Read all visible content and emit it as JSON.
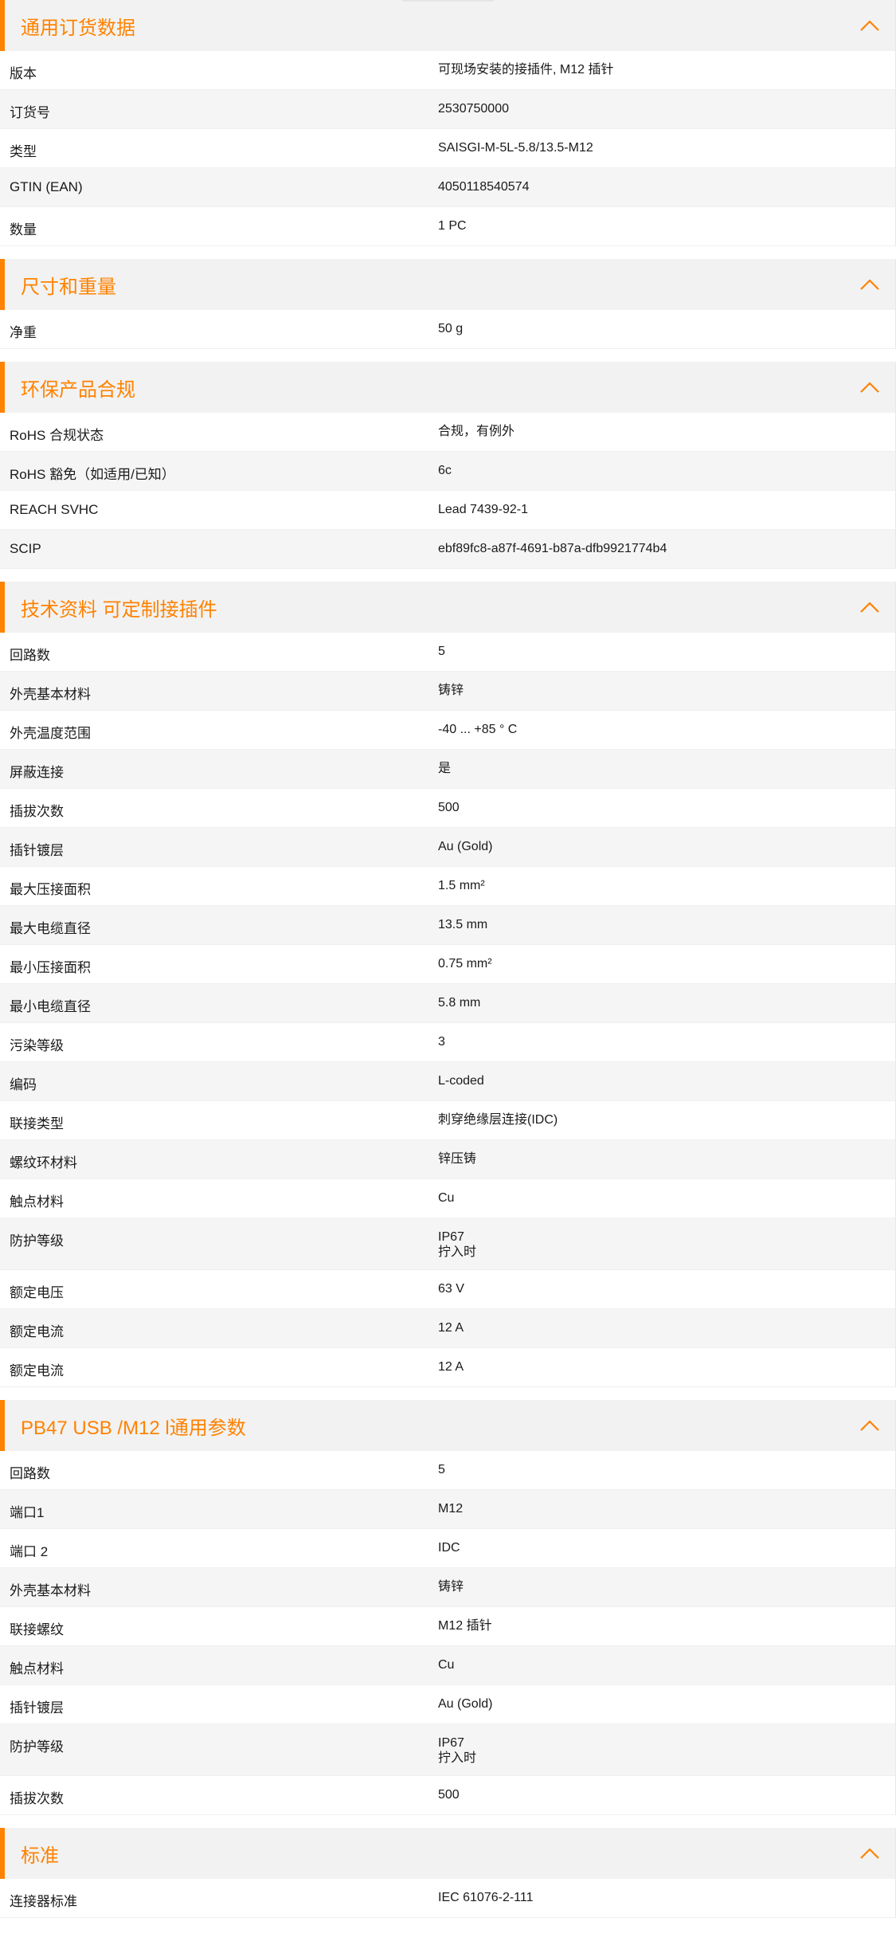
{
  "accent_color": "#ff8200",
  "icon_collapse": "chevron-up-icon",
  "sections": [
    {
      "title": "通用订货数据",
      "rows": [
        {
          "key": "版本",
          "value": "可现场安装的接插件, M12 插针"
        },
        {
          "key": "订货号",
          "value": "2530750000"
        },
        {
          "key": "类型",
          "value": "SAISGI-M-5L-5.8/13.5-M12"
        },
        {
          "key": "GTIN (EAN)",
          "value": "4050118540574"
        },
        {
          "key": "数量",
          "value": "1  PC"
        }
      ]
    },
    {
      "title": "尺寸和重量",
      "rows": [
        {
          "key": "净重",
          "value": "50  g"
        }
      ]
    },
    {
      "title": "环保产品合规",
      "rows": [
        {
          "key": "RoHS 合规状态",
          "value": "合规，有例外"
        },
        {
          "key": "RoHS 豁免（如适用/已知）",
          "value": "6c"
        },
        {
          "key": "REACH SVHC",
          "value": "Lead 7439-92-1"
        },
        {
          "key": "SCIP",
          "value": "ebf89fc8-a87f-4691-b87a-dfb9921774b4"
        }
      ]
    },
    {
      "title": "技术资料 可定制接插件",
      "rows": [
        {
          "key": "回路数",
          "value": "5"
        },
        {
          "key": "外壳基本材料",
          "value": "铸锌"
        },
        {
          "key": "外壳温度范围",
          "value": "-40 ... +85 ° C"
        },
        {
          "key": "屏蔽连接",
          "value": "是"
        },
        {
          "key": "插拔次数",
          "value": "500"
        },
        {
          "key": "插针镀层",
          "value": "Au (Gold)"
        },
        {
          "key": "最大压接面积",
          "value": "1.5  mm²"
        },
        {
          "key": "最大电缆直径",
          "value": "13.5  mm"
        },
        {
          "key": "最小压接面积",
          "value": "0.75  mm²"
        },
        {
          "key": "最小电缆直径",
          "value": "5.8  mm"
        },
        {
          "key": "污染等级",
          "value": "3"
        },
        {
          "key": "编码",
          "value": "L-coded"
        },
        {
          "key": "联接类型",
          "value": "刺穿绝缘层连接(IDC)"
        },
        {
          "key": "螺纹环材料",
          "value": "锌压铸"
        },
        {
          "key": "触点材料",
          "value": "Cu"
        },
        {
          "key": "防护等级",
          "value": "IP67\n拧入时"
        },
        {
          "key": "额定电压",
          "value": "63  V"
        },
        {
          "key": "额定电流",
          "value": "12  A"
        },
        {
          "key": "额定电流",
          "value": "12 A"
        }
      ]
    },
    {
      "title": "PB47 USB /M12 l通用参数",
      "rows": [
        {
          "key": "回路数",
          "value": "5"
        },
        {
          "key": "端口1",
          "value": "M12"
        },
        {
          "key": "端口 2",
          "value": "IDC"
        },
        {
          "key": "外壳基本材料",
          "value": "铸锌"
        },
        {
          "key": "联接螺纹",
          "value": "M12 插针"
        },
        {
          "key": "触点材料",
          "value": "Cu"
        },
        {
          "key": "插针镀层",
          "value": "Au (Gold)"
        },
        {
          "key": "防护等级",
          "value": "IP67\n拧入时"
        },
        {
          "key": "插拔次数",
          "value": "500"
        }
      ]
    },
    {
      "title": "标准",
      "rows": [
        {
          "key": "连接器标准",
          "value": "IEC 61076-2-111"
        }
      ]
    }
  ]
}
